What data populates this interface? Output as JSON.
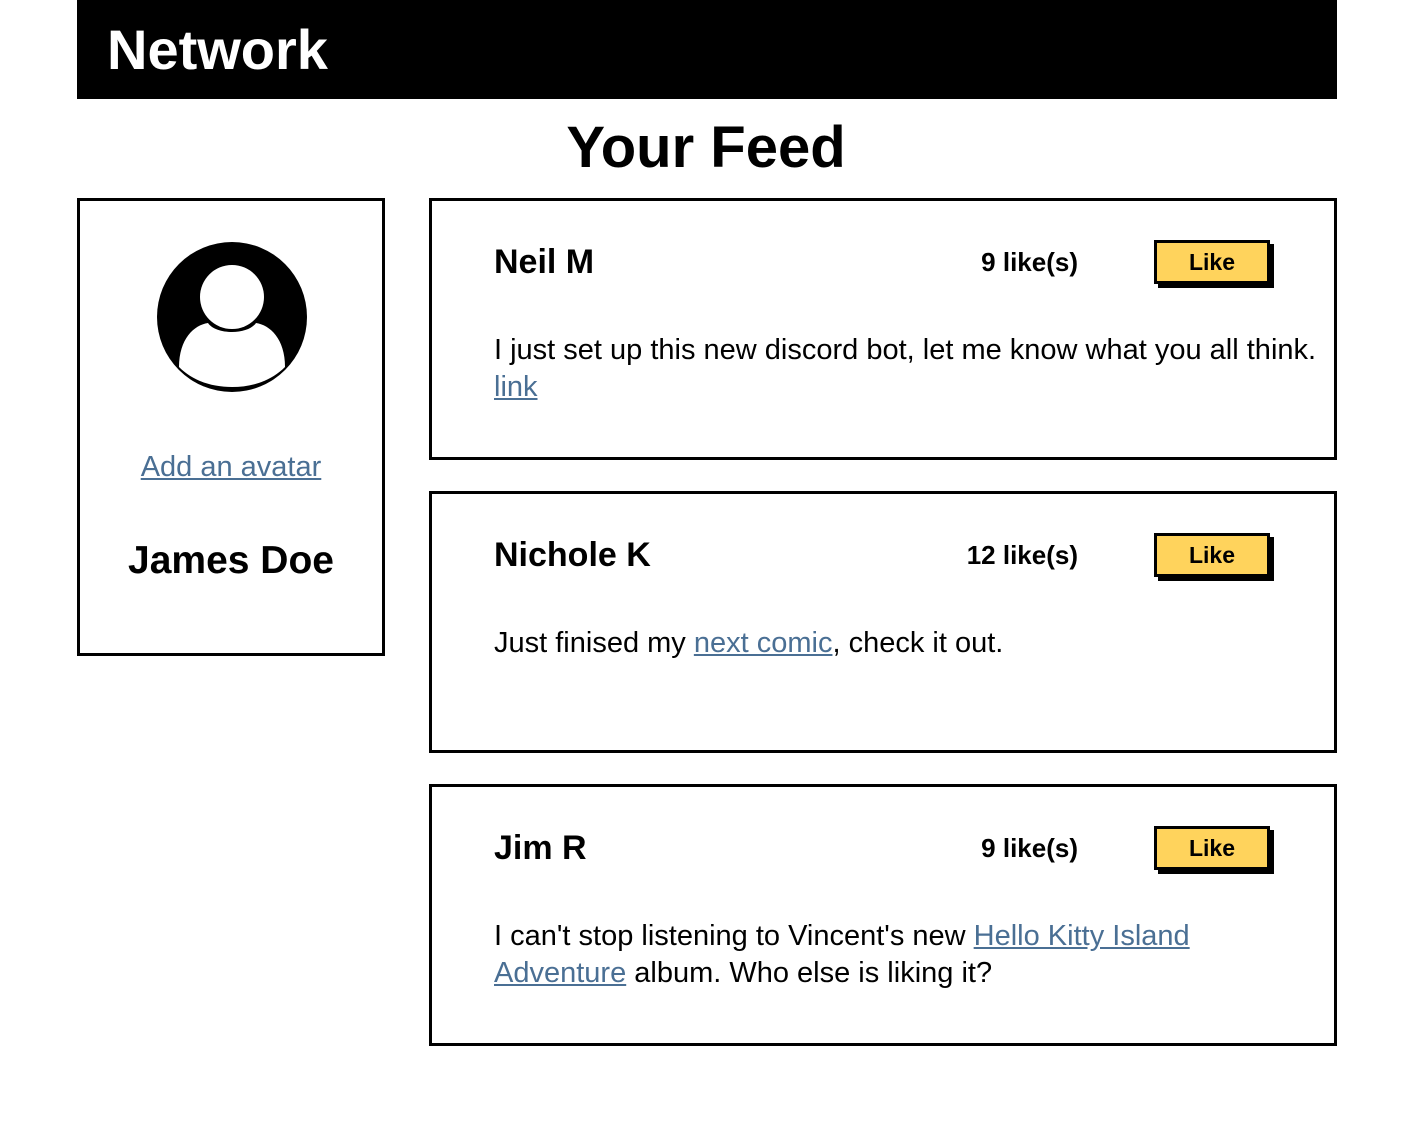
{
  "header": {
    "brand": "Network"
  },
  "page": {
    "title": "Your Feed"
  },
  "profile": {
    "avatar_icon": "user-circle-icon",
    "add_avatar_label": "Add an avatar",
    "name": "James Doe"
  },
  "posts": [
    {
      "author": "Neil M",
      "likes": "9 like(s)",
      "like_label": "Like",
      "text_before": "I just set up this new discord bot, let me know what you all think. ",
      "link_text": "link",
      "text_after": ""
    },
    {
      "author": "Nichole K",
      "likes": "12 like(s)",
      "like_label": "Like",
      "text_before": "Just finised my ",
      "link_text": "next comic",
      "text_after": ", check it out."
    },
    {
      "author": "Jim R",
      "likes": "9 like(s)",
      "like_label": "Like",
      "text_before": "I can't stop listening to Vincent's new ",
      "link_text": "Hello Kitty Island Adventure",
      "text_after": " album. Who else is liking it?"
    }
  ],
  "colors": {
    "header_bg": "#000000",
    "like_button_bg": "#ffd35c",
    "link": "#4a6f94"
  }
}
